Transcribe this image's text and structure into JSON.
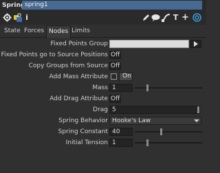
{
  "header": {
    "node_type": "Spring",
    "node_name": "spring1"
  },
  "toolbar": {
    "left_icons": [
      "gear-icon",
      "python-lock-icon",
      "info-icon"
    ],
    "right_icons": [
      "pencil-icon",
      "comment-icon",
      "wire-icon",
      "text-icon",
      "plus-icon",
      "target-icon"
    ]
  },
  "tabs": [
    {
      "label": "State",
      "active": false
    },
    {
      "label": "Forces",
      "active": false
    },
    {
      "label": "Nodes",
      "active": true
    },
    {
      "label": "Limits",
      "active": false
    }
  ],
  "params": {
    "fixed_points_group": {
      "label": "Fixed Points Group",
      "value": ""
    },
    "fixed_to_source": {
      "label": "Fixed Points go to Source Positions",
      "value": "Off"
    },
    "copy_groups": {
      "label": "Copy Groups from Source",
      "value": "Off"
    },
    "add_mass_attr": {
      "label": "Add Mass Attribute",
      "value": "On"
    },
    "mass": {
      "label": "Mass",
      "value": "1"
    },
    "add_drag_attr": {
      "label": "Add Drag Attribute",
      "value": "Off"
    },
    "drag": {
      "label": "Drag",
      "value": "5"
    },
    "spring_behavior": {
      "label": "Spring Behavior",
      "value": "Hooke's Law"
    },
    "spring_constant": {
      "label": "Spring Constant",
      "value": "40"
    },
    "initial_tension": {
      "label": "Initial Tension",
      "value": "1"
    }
  }
}
